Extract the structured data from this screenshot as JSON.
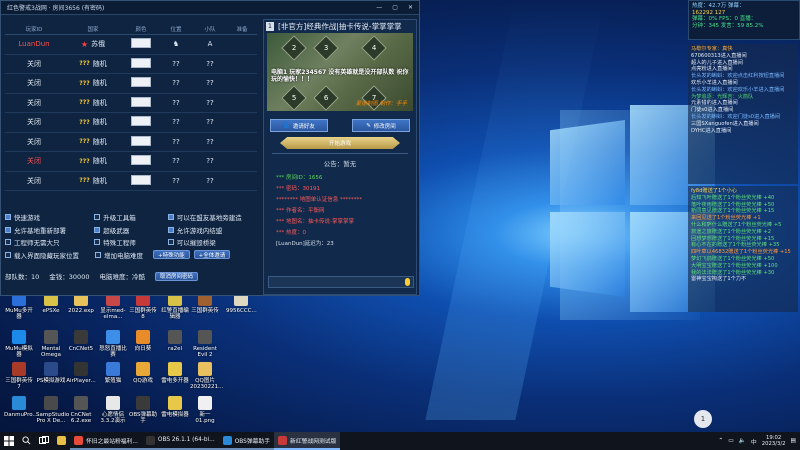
{
  "window": {
    "title": "红色警戒3战网 · 房间3656 (有密码)",
    "controls": [
      "—",
      "▢",
      "✕"
    ]
  },
  "player_table": {
    "headers": [
      "玩家ID",
      "国家",
      "颜色",
      "位置",
      "小队",
      "准备"
    ],
    "rows": [
      {
        "id": "LuanDun",
        "id_color": "red",
        "country": "苏俄",
        "country_icon": "star",
        "color_box": true,
        "position": "♞",
        "team": "A",
        "ready": ""
      },
      {
        "id": "关闭",
        "id_color": "white",
        "country": "随机",
        "country_icon": "qm",
        "color_box": true,
        "position": "??",
        "team": "??",
        "ready": ""
      },
      {
        "id": "关闭",
        "id_color": "white",
        "country": "随机",
        "country_icon": "qm",
        "color_box": true,
        "position": "??",
        "team": "??",
        "ready": ""
      },
      {
        "id": "关闭",
        "id_color": "white",
        "country": "随机",
        "country_icon": "qm",
        "color_box": true,
        "position": "??",
        "team": "??",
        "ready": ""
      },
      {
        "id": "关闭",
        "id_color": "white",
        "country": "随机",
        "country_icon": "qm",
        "color_box": true,
        "position": "??",
        "team": "??",
        "ready": ""
      },
      {
        "id": "关闭",
        "id_color": "white",
        "country": "随机",
        "country_icon": "qm",
        "color_box": true,
        "position": "??",
        "team": "??",
        "ready": ""
      },
      {
        "id": "关闭",
        "id_color": "red",
        "country": "随机",
        "country_icon": "qm",
        "color_box": true,
        "position": "??",
        "team": "??",
        "ready": ""
      },
      {
        "id": "关闭",
        "id_color": "white",
        "country": "随机",
        "country_icon": "qm",
        "color_box": true,
        "position": "??",
        "team": "??",
        "ready": ""
      }
    ]
  },
  "options": [
    [
      {
        "label": "快速游戏",
        "checked": true
      },
      {
        "label": "升级工具箱",
        "checked": false
      },
      {
        "label": "可以在盟友基地旁建造",
        "checked": true
      }
    ],
    [
      {
        "label": "允许基地重新部署",
        "checked": true
      },
      {
        "label": "超级武器",
        "checked": true
      },
      {
        "label": "允许游戏内结盟",
        "checked": true
      }
    ],
    [
      {
        "label": "工程师无需大只",
        "checked": false
      },
      {
        "label": "特殊工程师",
        "checked": false
      },
      {
        "label": "可以摧毁桥梁",
        "checked": false
      }
    ],
    [
      {
        "label": "载入界面隐藏玩家位置",
        "checked": false
      },
      {
        "label": "增加电脑难度",
        "checked": false
      }
    ]
  ],
  "option_buttons": {
    "special": "+特殊功能",
    "all_apply": "+全体邀请"
  },
  "stats": {
    "ai_count": "部队数：10",
    "money": "金钱：30000",
    "ai_level": "电脑难度：冷酷",
    "cancel_password": "取消房间密码"
  },
  "room": {
    "index": "1",
    "title": "[非官方]经典作战|抽卡传说-掌掌掌掌",
    "map_text": "电脑1  玩家234567  没有英雄就是没开部队数  祝你玩的愉快！！！",
    "map_watermark": "蒙德制图 制作：手手",
    "tiles": [
      "2",
      "3",
      "4",
      "5",
      "6",
      "7"
    ],
    "invite_btn": "邀请好友",
    "modify_btn": "修改房间",
    "start_btn": "开始游戏",
    "notice_label": "公告：",
    "notice_value": "暂无",
    "info_lines": [
      {
        "text": "*** 房间ID：1656",
        "cls": "g"
      },
      {
        "text": "*** 密码：30191",
        "cls": "r"
      },
      {
        "text": "********  地图单认证信息 ********",
        "cls": "r"
      },
      {
        "text": "*** 作者名：平衡网",
        "cls": "r"
      },
      {
        "text": "*** 地图名：抽卡传说-掌掌掌掌",
        "cls": "r"
      },
      {
        "text": "*** 热度：0",
        "cls": "r"
      },
      {
        "text": "[LuanDun]延迟为：23",
        "cls": "w"
      }
    ]
  },
  "stats_panel": {
    "lines": [
      {
        "text": "热度：42.7万   弹幕：",
        "cls": "c"
      },
      {
        "text": "162292          127",
        "cls": "y"
      },
      {
        "text": "弹幕：0%  FPS：0   直播：",
        "cls": "g"
      },
      {
        "text": "分钟：345   发言：59    85.2%",
        "cls": "g"
      }
    ]
  },
  "feed": [
    {
      "text": "马歇尔专家：真快",
      "cls": "o"
    },
    {
      "text": "670600313进入直播间",
      "cls": "w"
    },
    {
      "text": "超人的儿子进入直播间",
      "cls": "w"
    },
    {
      "text": "点亮粉进入直播间",
      "cls": "w"
    },
    {
      "text": "长头发的蝌蚪：欢迎点击红利按钮直播间",
      "cls": "b"
    },
    {
      "text": "欢乐小羊进入直播间",
      "cls": "w"
    },
    {
      "text": "长头发的蝌蚪：欢迎欢乐小羊进入直播间",
      "cls": "b"
    },
    {
      "text": "为梦追逐：光辉吉：火箭队",
      "cls": "g"
    },
    {
      "text": "元素猎豹进入直播间",
      "cls": "w"
    },
    {
      "text": "门徒s0进入直播间",
      "cls": "w"
    },
    {
      "text": "长头发的蝌蚪：欢迎门徒s0进入直播间",
      "cls": "b"
    },
    {
      "text": "三国SXanguofen进入直播间",
      "cls": "w"
    },
    {
      "text": "DYHC进入直播间",
      "cls": "w"
    }
  ],
  "feed2": [
    {
      "text": "fy8d赠送了1个小心",
      "cls": "y"
    },
    {
      "text": "后知飞叶赠送了1个粉丝荧光棒 +40",
      "cls": "g"
    },
    {
      "text": "落叶夜雨赠送了1个粉丝荧光棒 +50",
      "cls": "g"
    },
    {
      "text": "新同意见赠送了1个粉丝荧光棒 +15",
      "cls": "g"
    },
    {
      "text": "来回见送了1个粉丝荧光棒 +1",
      "cls": "o"
    },
    {
      "text": "什么和萨什么赠送了1个粉丝荧光棒 +5",
      "cls": "g"
    },
    {
      "text": "旅途之旅赠送了1个粉丝荧光棒 +2",
      "cls": "g"
    },
    {
      "text": "回想梦想赠送了1个粉丝荧光棒 +15",
      "cls": "g"
    },
    {
      "text": "有心不在的赠送了1个粉丝荧光棒 +35",
      "cls": "g"
    },
    {
      "text": "四叶草以46832赠送了1个粉丝荧光棒 +15",
      "cls": "o"
    },
    {
      "text": "梦幻飞鸽赠送了1个粉丝荧光棒 +50",
      "cls": "g"
    },
    {
      "text": "大明宝宝赠送了1个粉丝荧光棒 +100",
      "cls": "g"
    },
    {
      "text": "我的法法赠送了1个粉丝荧光棒 +30",
      "cls": "g"
    },
    {
      "text": "雷神宝宝掏送了1个力不",
      "cls": "w"
    }
  ],
  "desktop_icons": [
    {
      "name": "MuMu多开器",
      "color": "#2b6fd8"
    },
    {
      "name": "ePSXe",
      "color": "#d8c248"
    },
    {
      "name": "2022.exp",
      "color": "#e8c25a"
    },
    {
      "name": "显示med-elma...",
      "color": "#c84848"
    },
    {
      "name": "三国群英传8",
      "color": "#c83a3a"
    },
    {
      "name": "红警直播编辑器",
      "color": "#d8c248"
    },
    {
      "name": "三国群英传",
      "color": "#a06030"
    },
    {
      "name": "9956CCC...",
      "color": "#e0d8c0"
    },
    {
      "name": "MuMu模拟器",
      "color": "#1c8ae8"
    },
    {
      "name": "Mental Omega",
      "color": "#555"
    },
    {
      "name": "CnCNet5",
      "color": "#3a3a3a"
    },
    {
      "name": "怒怒直播比赛",
      "color": "#3d8ee8"
    },
    {
      "name": "向日葵",
      "color": "#e88c2a"
    },
    {
      "name": "ra2el",
      "color": "#555"
    },
    {
      "name": "Resident Evil 2",
      "color": "#555"
    },
    {
      "name": "三国群英传7",
      "color": "#a83a2a"
    },
    {
      "name": "PS模拟游戏",
      "color": "#2a4a8a"
    },
    {
      "name": "AirPlayer...",
      "color": "#333"
    },
    {
      "name": "繁殖猫",
      "color": "#3a7ad8"
    },
    {
      "name": "QQ游戏",
      "color": "#e8a838"
    },
    {
      "name": "雷电多开器",
      "color": "#e8c848"
    },
    {
      "name": "QQ图片20230221...",
      "color": "#e8c060"
    },
    {
      "name": "DanmuPro...",
      "color": "#2a8ad8"
    },
    {
      "name": "SampStudio Pro X De...",
      "color": "#4a4a4a"
    },
    {
      "name": "CnCNet 6.2.exe",
      "color": "#555"
    },
    {
      "name": "心愿情侣3.3.2演示",
      "color": "#e8e8e8"
    },
    {
      "name": "OBS弹幕助手",
      "color": "#3a3a3a"
    },
    {
      "name": "雷电模拟器",
      "color": "#e8c848"
    },
    {
      "name": "新一01.png",
      "color": "#f0f0f0"
    }
  ],
  "taskbar": {
    "items": [
      {
        "label": "怀旧之最站粉福利...",
        "cls": "open",
        "color": "#e84a3a"
      },
      {
        "label": "OBS 26.1.1 (64-bi...",
        "cls": "open",
        "color": "#333"
      },
      {
        "label": "OBS弹幕助手",
        "cls": "open",
        "color": "#2a8ad8"
      },
      {
        "label": "新红警战网测试版",
        "cls": "active",
        "color": "#c83a3a"
      }
    ],
    "time": "19:02",
    "date": "2023/3/2",
    "badge": "1"
  }
}
